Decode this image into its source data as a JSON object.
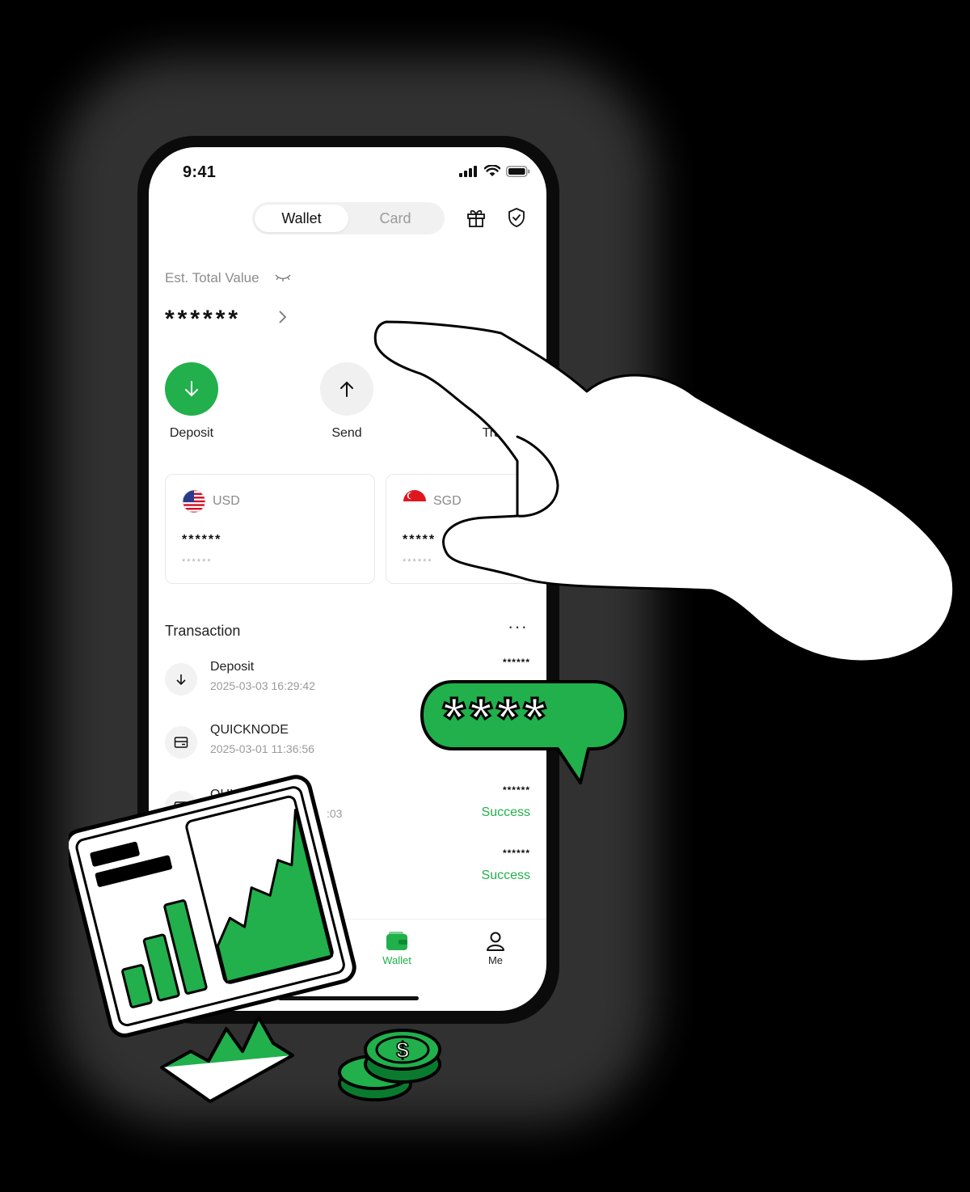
{
  "status_bar": {
    "time": "9:41"
  },
  "tabs": {
    "wallet": "Wallet",
    "card": "Card"
  },
  "balance": {
    "label": "Est. Total Value",
    "value": "******"
  },
  "actions": [
    {
      "label": "Deposit"
    },
    {
      "label": "Send"
    },
    {
      "label": "Transf"
    }
  ],
  "currencies": [
    {
      "code": "USD",
      "amount": "******",
      "sub": "******"
    },
    {
      "code": "SGD",
      "amount": "*****",
      "sub": "******"
    }
  ],
  "transactions": {
    "title": "Transaction",
    "more": "···",
    "items": [
      {
        "name": "Deposit",
        "date": "2025-03-03 16:29:42",
        "amount": "******",
        "status": ""
      },
      {
        "name": "QUICKNODE",
        "date": "2025-03-01 11:36:56",
        "amount": "",
        "status": ""
      },
      {
        "name": "QUIC",
        "date": ":03",
        "amount": "******",
        "status": "Success"
      },
      {
        "name": "",
        "date": "",
        "amount": "******",
        "status": "Success"
      }
    ]
  },
  "bottom_nav": {
    "wallet": "Wallet",
    "me": "Me"
  },
  "bubble": {
    "text": "****"
  },
  "colors": {
    "accent": "#21b04b",
    "dark_green": "#0a7a2f"
  }
}
